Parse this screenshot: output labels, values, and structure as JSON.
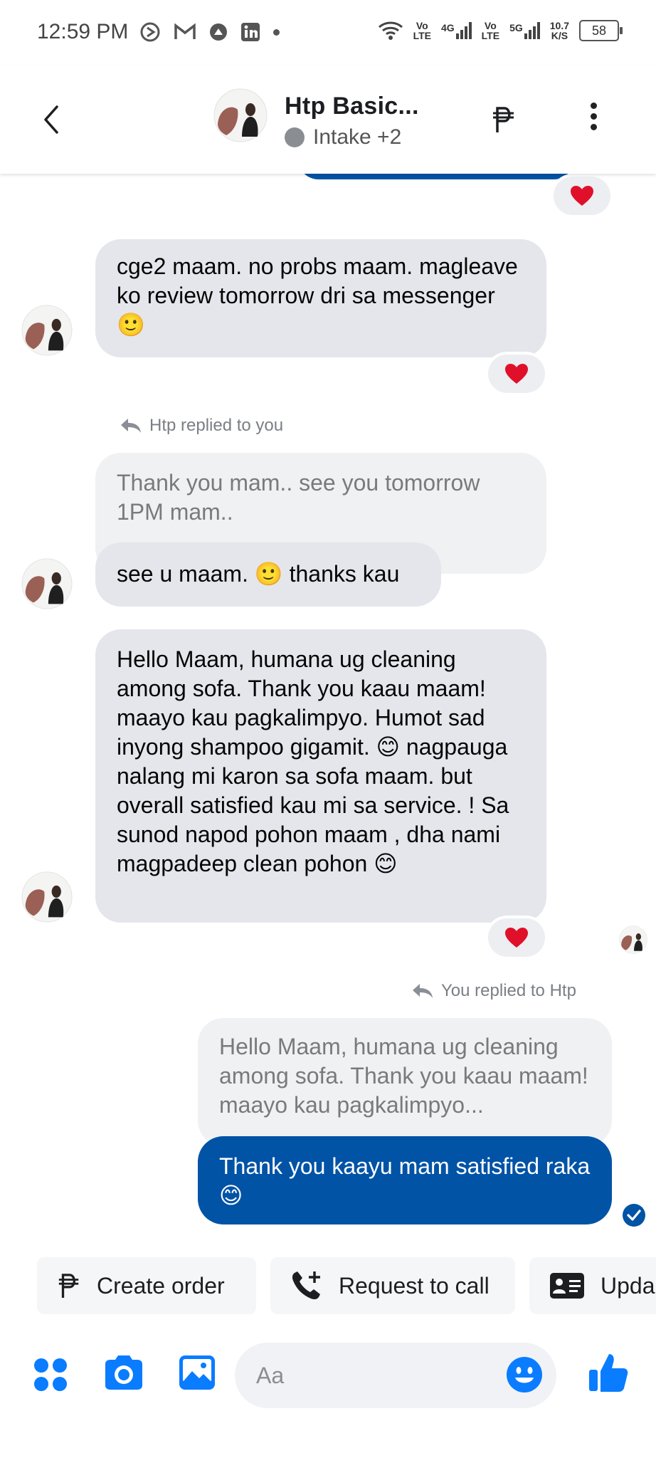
{
  "status_bar": {
    "time": "12:59 PM",
    "net1_top": "Vo",
    "net1_bottom": "LTE",
    "net2_top": "4G",
    "net3_top": "Vo",
    "net3_bottom": "LTE",
    "net4_top": "5G",
    "speed_top": "10.7",
    "speed_bottom": "K/S",
    "battery": "58"
  },
  "header": {
    "title": "Htp Basic...",
    "subtitle": "Intake +2",
    "icons": [
      "back-arrow",
      "peso-icon",
      "more-icon"
    ]
  },
  "messages": {
    "m1": {
      "text": "cge2 maam. no probs maam. magleave ko review tomorrow dri sa messenger 🙂"
    },
    "reply1": {
      "note": "Htp replied to you",
      "quoted": "Thank you mam.. see you tomorrow 1PM mam..",
      "text": "see u maam. 🙂 thanks kau"
    },
    "m3": {
      "text": "Hello Maam, humana ug cleaning among sofa. Thank you kaau maam! maayo kau pagkalimpyo. Humot sad inyong shampoo gigamit. 😊 nagpauga nalang mi karon sa sofa maam. but overall satisfied kau mi sa service. ! Sa sunod napod pohon maam , dha nami magpadeep clean pohon 😊"
    },
    "reply2": {
      "note": "You replied to Htp",
      "quoted": "Hello Maam, humana ug cleaning among sofa. Thank you kaau maam! maayo kau pagkalimpyo...",
      "text": "Thank you kaayu mam satisfied raka 😊"
    }
  },
  "quick_actions": {
    "create_order": "Create order",
    "request_call": "Request to call",
    "update": "Upda"
  },
  "composer": {
    "placeholder": "Aa"
  },
  "colors": {
    "outgoing_bubble": "#0153a6",
    "incoming_bubble": "#e4e6eb",
    "accent": "#0a7cff",
    "reaction_heart": "#e0102b"
  }
}
